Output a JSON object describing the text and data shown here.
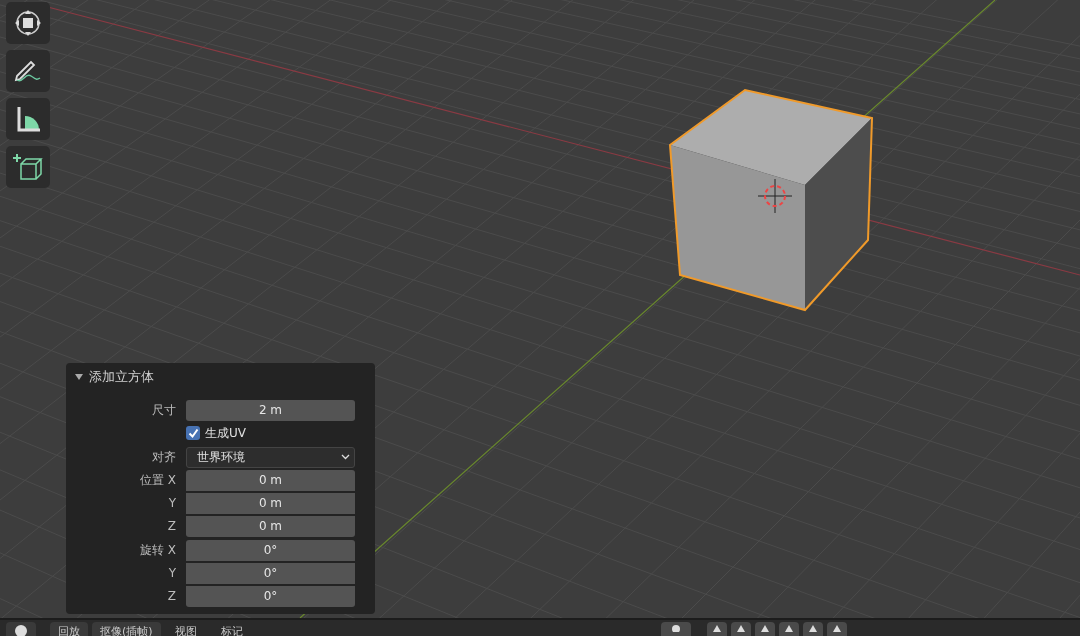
{
  "operator_panel": {
    "title": "添加立方体",
    "expanded": true,
    "size": {
      "label": "尺寸",
      "value": "2 m"
    },
    "generate_uv": {
      "label": "生成UV",
      "checked": true
    },
    "align": {
      "label": "对齐",
      "value": "世界环境"
    },
    "location": [
      {
        "label": "位置 X",
        "value": "0 m"
      },
      {
        "label": "Y",
        "value": "0 m"
      },
      {
        "label": "Z",
        "value": "0 m"
      }
    ],
    "rotation": [
      {
        "label": "旋转 X",
        "value": "0°"
      },
      {
        "label": "Y",
        "value": "0°"
      },
      {
        "label": "Z",
        "value": "0°"
      }
    ]
  },
  "timeline_header": {
    "menus": [
      {
        "label": "回放"
      },
      {
        "label": "抠像(插帧)"
      }
    ],
    "plain_menus": [
      {
        "label": "视图"
      },
      {
        "label": "标记"
      }
    ]
  }
}
